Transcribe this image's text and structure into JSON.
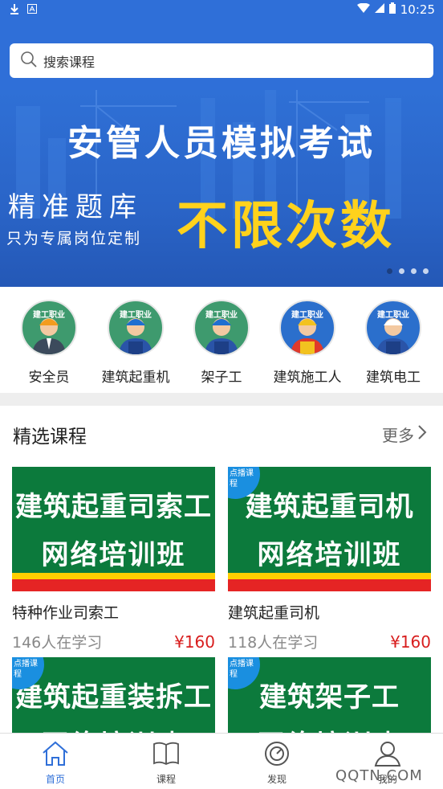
{
  "status_bar": {
    "time": "10:25"
  },
  "search": {
    "placeholder": "搜索课程"
  },
  "banner": {
    "title": "安管人员模拟考试",
    "line1": "精准题库",
    "line2": "只为专属岗位定制",
    "highlight": "不限次数",
    "highlight_color": "#ffd21c",
    "slides": 4,
    "active_slide": 1
  },
  "categories": [
    {
      "label": "安全员",
      "avatar_color": "#3e9a6e",
      "logo": "建工职业"
    },
    {
      "label": "建筑起重机",
      "avatar_color": "#3e9a6e",
      "logo": "建工职业"
    },
    {
      "label": "架子工",
      "avatar_color": "#3e9a6e",
      "logo": "建工职业"
    },
    {
      "label": "建筑施工人",
      "avatar_color": "#2b6fcc",
      "logo": "建工职业"
    },
    {
      "label": "建筑电工",
      "avatar_color": "#2b6fcc",
      "logo": "建工职业"
    }
  ],
  "section": {
    "title": "精选课程",
    "more": "更多"
  },
  "courses": [
    {
      "thumb_line1": "建筑起重司索工",
      "thumb_line2": "网络培训班",
      "badge": "",
      "name": "特种作业司索工",
      "learners": "146人在学习",
      "price": "¥160"
    },
    {
      "thumb_line1": "建筑起重司机",
      "thumb_line2": "网络培训班",
      "badge": "点播课程",
      "name": "建筑起重司机",
      "learners": "118人在学习",
      "price": "¥160"
    },
    {
      "thumb_line1": "建筑起重装拆工",
      "thumb_line2": "网络培训班",
      "badge": "点播课程",
      "name": "",
      "learners": "",
      "price": ""
    },
    {
      "thumb_line1": "建筑架子工",
      "thumb_line2": "网络培训班",
      "badge": "点播课程",
      "name": "",
      "learners": "",
      "price": ""
    }
  ],
  "nav": [
    {
      "label": "首页",
      "icon": "home-icon",
      "active": true
    },
    {
      "label": "课程",
      "icon": "book-icon",
      "active": false
    },
    {
      "label": "发现",
      "icon": "compass-icon",
      "active": false
    },
    {
      "label": "我的",
      "icon": "user-icon",
      "active": false
    }
  ],
  "watermark": "QQTN.COM",
  "colors": {
    "brand": "#2f6fd8",
    "price": "#d81e1e",
    "course_bg": "#0c7a3c"
  }
}
